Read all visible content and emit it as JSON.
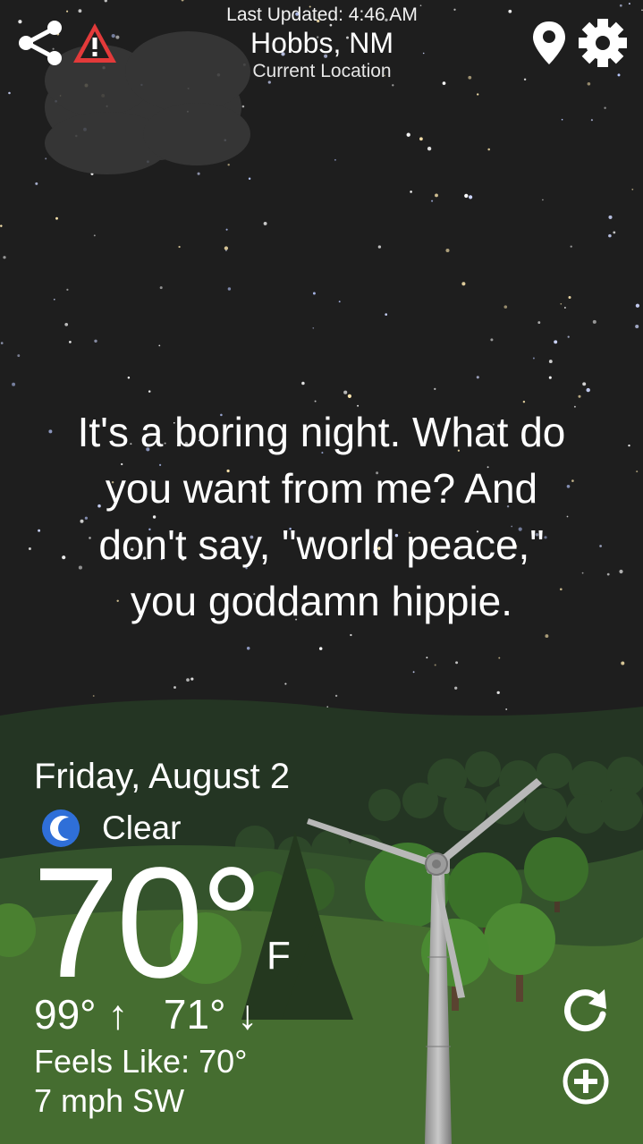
{
  "header": {
    "last_updated": "Last Updated: 4:46 AM",
    "city": "Hobbs, NM",
    "location_label": "Current Location"
  },
  "icons": {
    "share": "share-icon",
    "alert": "warning-triangle-icon",
    "location": "map-pin-icon",
    "settings": "gear-icon",
    "condition": "crescent-moon-icon",
    "refresh": "refresh-icon",
    "add": "plus-circle-icon"
  },
  "message": {
    "lines": [
      "It's a boring night. What do",
      "you want from me? And",
      "don't say, \"world peace,\"",
      "you goddamn hippie."
    ]
  },
  "weather": {
    "date": "Friday, August 2",
    "condition": "Clear",
    "temperature": "70°",
    "unit": "F",
    "high": "99°",
    "high_arrow": "↑",
    "low": "71°",
    "low_arrow": "↓",
    "feels_like": "Feels Like: 70°",
    "wind": "7 mph SW"
  },
  "colors": {
    "sky": "#1e1e1e",
    "hills": "#3b5a2c",
    "text": "#ffffff",
    "alert_red": "#e33a3a",
    "moon_blue": "#2f6fd8"
  }
}
